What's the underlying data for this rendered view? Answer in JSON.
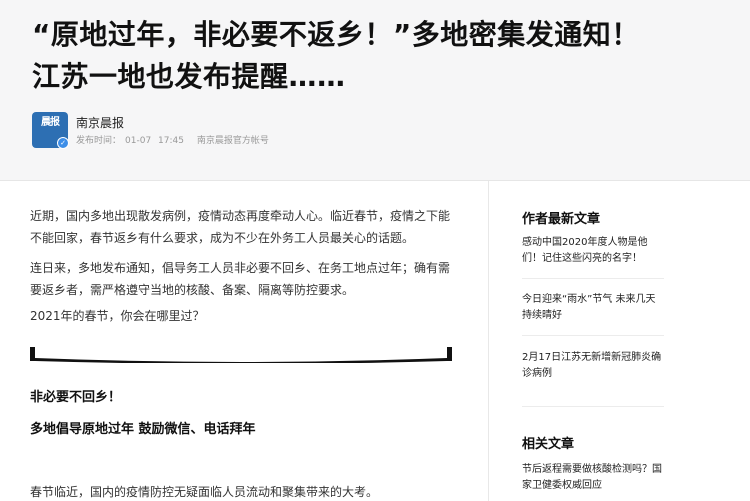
{
  "article": {
    "title_line1": "“原地过年，非必要不返乡！”多地密集发通知！",
    "title_line2": "江苏一地也发布提醒……",
    "author": "南京晨报",
    "avatar_text": "晨报",
    "publish_label": "发布时间：",
    "publish_date": "01-07",
    "publish_time": "17:45",
    "account_label": "南京晨报官方帐号",
    "paragraphs": [
      "近期，国内多地出现散发病例，疫情动态再度牵动人心。临近春节，疫情之下能不能回家，春节返乡有什么要求，成为不少在外务工人员最关心的话题。",
      "连日来，多地发布通知，倡导务工人员非必要不回乡、在务工地点过年；确有需要返乡者，需严格遵守当地的核酸、备案、隔离等防控要求。",
      "2021年的春节，你会在哪里过？"
    ],
    "subheads": [
      "非必要不回乡！",
      "多地倡导原地过年 鼓励微信、电话拜年"
    ],
    "last_paragraph": "春节临近，国内的疫情防控无疑面临人员流动和聚集带来的大考。"
  },
  "sidebar": {
    "latest_title": "作者最新文章",
    "latest": [
      "感动中国2020年度人物是他们！记住这些闪亮的名字！",
      "今日迎来“雨水”节气 未来几天持续晴好",
      "2月17日江苏无新增新冠肺炎确诊病例"
    ],
    "related_title": "相关文章",
    "related": [
      "节后返程需要做核酸检测吗？国家卫健委权威回应"
    ]
  },
  "colors": {
    "header_bg": "#f6f6f7",
    "avatar_bg": "#2d6fb3",
    "verified": "#3d8ee8"
  },
  "icons": {
    "verified": "verified-badge-icon"
  }
}
